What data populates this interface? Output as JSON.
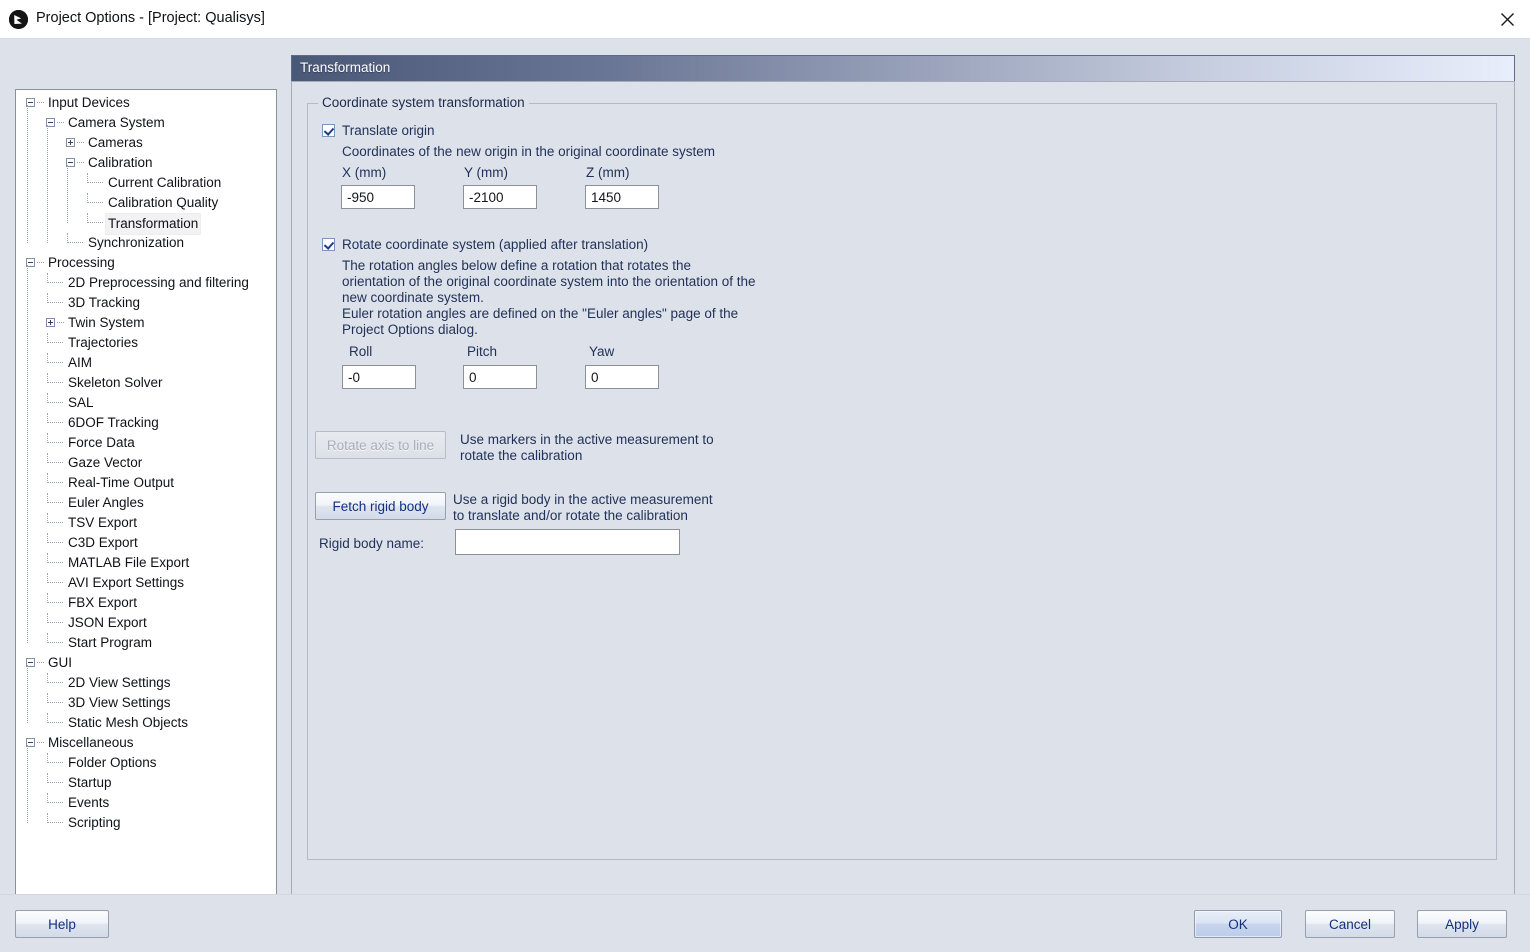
{
  "window": {
    "title": "Project Options - [Project: Qualisys]",
    "app_icon": "qualisys-logo-icon",
    "close_icon": "close-icon"
  },
  "sidebar": {
    "items": [
      {
        "label": "Input Devices",
        "depth": 0,
        "toggle": "minus",
        "selected": false
      },
      {
        "label": "Camera System",
        "depth": 1,
        "toggle": "minus",
        "selected": false
      },
      {
        "label": "Cameras",
        "depth": 2,
        "toggle": "plus",
        "selected": false
      },
      {
        "label": "Calibration",
        "depth": 2,
        "toggle": "minus",
        "selected": false
      },
      {
        "label": "Current Calibration",
        "depth": 3,
        "toggle": "none",
        "selected": false
      },
      {
        "label": "Calibration Quality",
        "depth": 3,
        "toggle": "none",
        "selected": false
      },
      {
        "label": "Transformation",
        "depth": 3,
        "toggle": "none",
        "selected": true
      },
      {
        "label": "Synchronization",
        "depth": 2,
        "toggle": "none",
        "selected": false
      },
      {
        "label": "Processing",
        "depth": 0,
        "toggle": "minus",
        "selected": false
      },
      {
        "label": "2D Preprocessing and filtering",
        "depth": 1,
        "toggle": "none",
        "selected": false
      },
      {
        "label": "3D Tracking",
        "depth": 1,
        "toggle": "none",
        "selected": false
      },
      {
        "label": "Twin System",
        "depth": 1,
        "toggle": "plus",
        "selected": false
      },
      {
        "label": "Trajectories",
        "depth": 1,
        "toggle": "none",
        "selected": false
      },
      {
        "label": "AIM",
        "depth": 1,
        "toggle": "none",
        "selected": false
      },
      {
        "label": "Skeleton Solver",
        "depth": 1,
        "toggle": "none",
        "selected": false
      },
      {
        "label": "SAL",
        "depth": 1,
        "toggle": "none",
        "selected": false
      },
      {
        "label": "6DOF Tracking",
        "depth": 1,
        "toggle": "none",
        "selected": false
      },
      {
        "label": "Force Data",
        "depth": 1,
        "toggle": "none",
        "selected": false
      },
      {
        "label": "Gaze Vector",
        "depth": 1,
        "toggle": "none",
        "selected": false
      },
      {
        "label": "Real-Time Output",
        "depth": 1,
        "toggle": "none",
        "selected": false
      },
      {
        "label": "Euler Angles",
        "depth": 1,
        "toggle": "none",
        "selected": false
      },
      {
        "label": "TSV Export",
        "depth": 1,
        "toggle": "none",
        "selected": false
      },
      {
        "label": "C3D Export",
        "depth": 1,
        "toggle": "none",
        "selected": false
      },
      {
        "label": "MATLAB File Export",
        "depth": 1,
        "toggle": "none",
        "selected": false
      },
      {
        "label": "AVI Export Settings",
        "depth": 1,
        "toggle": "none",
        "selected": false
      },
      {
        "label": "FBX Export",
        "depth": 1,
        "toggle": "none",
        "selected": false
      },
      {
        "label": "JSON Export",
        "depth": 1,
        "toggle": "none",
        "selected": false
      },
      {
        "label": "Start Program",
        "depth": 1,
        "toggle": "none",
        "selected": false
      },
      {
        "label": "GUI",
        "depth": 0,
        "toggle": "minus",
        "selected": false
      },
      {
        "label": "2D View Settings",
        "depth": 1,
        "toggle": "none",
        "selected": false
      },
      {
        "label": "3D View Settings",
        "depth": 1,
        "toggle": "none",
        "selected": false
      },
      {
        "label": "Static Mesh Objects",
        "depth": 1,
        "toggle": "none",
        "selected": false
      },
      {
        "label": "Miscellaneous",
        "depth": 0,
        "toggle": "minus",
        "selected": false
      },
      {
        "label": "Folder Options",
        "depth": 1,
        "toggle": "none",
        "selected": false
      },
      {
        "label": "Startup",
        "depth": 1,
        "toggle": "none",
        "selected": false
      },
      {
        "label": "Events",
        "depth": 1,
        "toggle": "none",
        "selected": false
      },
      {
        "label": "Scripting",
        "depth": 1,
        "toggle": "none",
        "selected": false
      }
    ]
  },
  "page": {
    "header_title": "Transformation",
    "group_title": "Coordinate system transformation",
    "translate": {
      "checkbox_label": "Translate origin",
      "checked": true,
      "description": "Coordinates of the new origin in the original coordinate system",
      "fields": [
        {
          "label": "X (mm)",
          "value": "-950"
        },
        {
          "label": "Y (mm)",
          "value": "-2100"
        },
        {
          "label": "Z (mm)",
          "value": "1450"
        }
      ]
    },
    "rotate": {
      "checkbox_label": "Rotate coordinate system (applied after translation)",
      "checked": true,
      "description": "The rotation angles below define a rotation that rotates the\norientation of the original coordinate system into the orientation of the\nnew coordinate system.\nEuler rotation angles are defined on the \"Euler angles\" page of the\nProject Options dialog.",
      "fields": [
        {
          "label": "Roll",
          "value": "-0"
        },
        {
          "label": "Pitch",
          "value": "0"
        },
        {
          "label": "Yaw",
          "value": "0"
        }
      ]
    },
    "rotate_axis": {
      "button_label": "Rotate axis to line",
      "disabled": true,
      "description": "Use markers in the active measurement to\nrotate the calibration"
    },
    "fetch_rigid_body": {
      "button_label": "Fetch rigid body",
      "disabled": false,
      "description": "Use a rigid body in the active measurement\nto translate and/or rotate the calibration",
      "name_label": "Rigid body name:",
      "name_value": "",
      "name_placeholder": ""
    }
  },
  "footer": {
    "help_label": "Help",
    "ok_label": "OK",
    "cancel_label": "Cancel",
    "apply_label": "Apply"
  },
  "colors": {
    "dialog_background": "#dde1ea",
    "header_gradient_start": "#4a5878",
    "header_gradient_end": "#e8eefb",
    "label_text": "#1f3157",
    "button_text": "#12307e",
    "tree_background": "#ffffff"
  }
}
